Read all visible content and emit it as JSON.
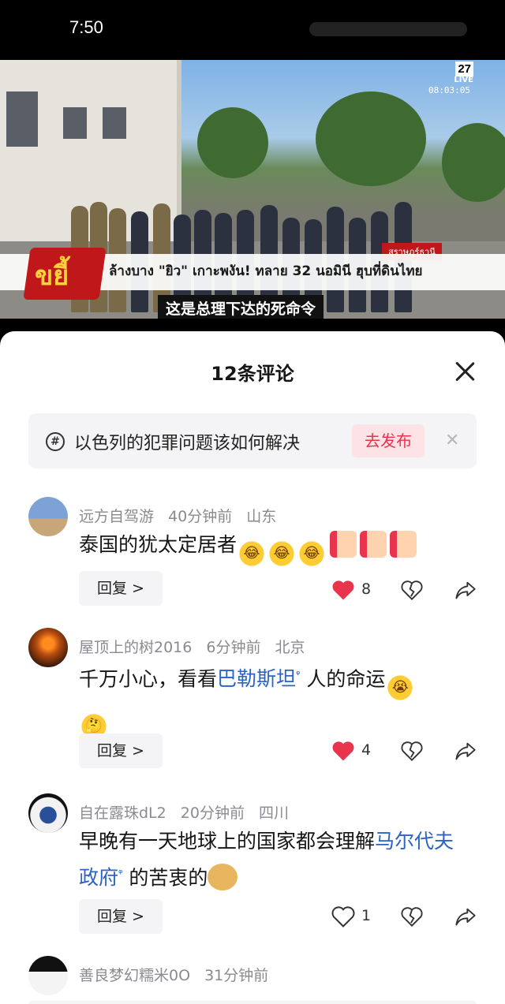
{
  "status_bar": {
    "time": "7:50"
  },
  "video": {
    "channel_number": "27",
    "live_label": "LIVE",
    "timecode": "08:03:05",
    "program_logo": "ขยี้",
    "location": "สุราษฎร์ธานี",
    "headline": "ล้างบาง \"ยิว\" เกาะพงัน! ทลาย 32 นอมินี ฮุบที่ดินไทย",
    "subtitle": "这是总理下达的死命令"
  },
  "sheet": {
    "title": "12条评论",
    "topic": {
      "text": "以色列的犯罪问题该如何解决",
      "button": "去发布"
    }
  },
  "comments": [
    {
      "user": "远方自驾游",
      "time": "40分钟前",
      "location": "山东",
      "text": "泰国的犹太定居者",
      "reply": "回复 >",
      "likes": "8",
      "liked": true
    },
    {
      "user": "屋顶上的树2016",
      "time": "6分钟前",
      "location": "北京",
      "text_before": "千万小心，看看",
      "link": "巴勒斯坦",
      "text_after": " 人的命运",
      "reply": "回复 >",
      "likes": "4",
      "liked": true
    },
    {
      "user": "自在露珠dL2",
      "time": "20分钟前",
      "location": "四川",
      "text_before": "早晚有一天地球上的国家都会理解",
      "link": "马尔代夫政府",
      "text_after": " 的苦衷的",
      "reply": "回复 >",
      "likes": "1",
      "liked": false
    },
    {
      "user": "善良梦幻糯米0O",
      "time": "31分钟前"
    }
  ],
  "colors": {
    "accent": "#e8344c",
    "link": "#2c63c7",
    "meta": "#8a8a90"
  }
}
